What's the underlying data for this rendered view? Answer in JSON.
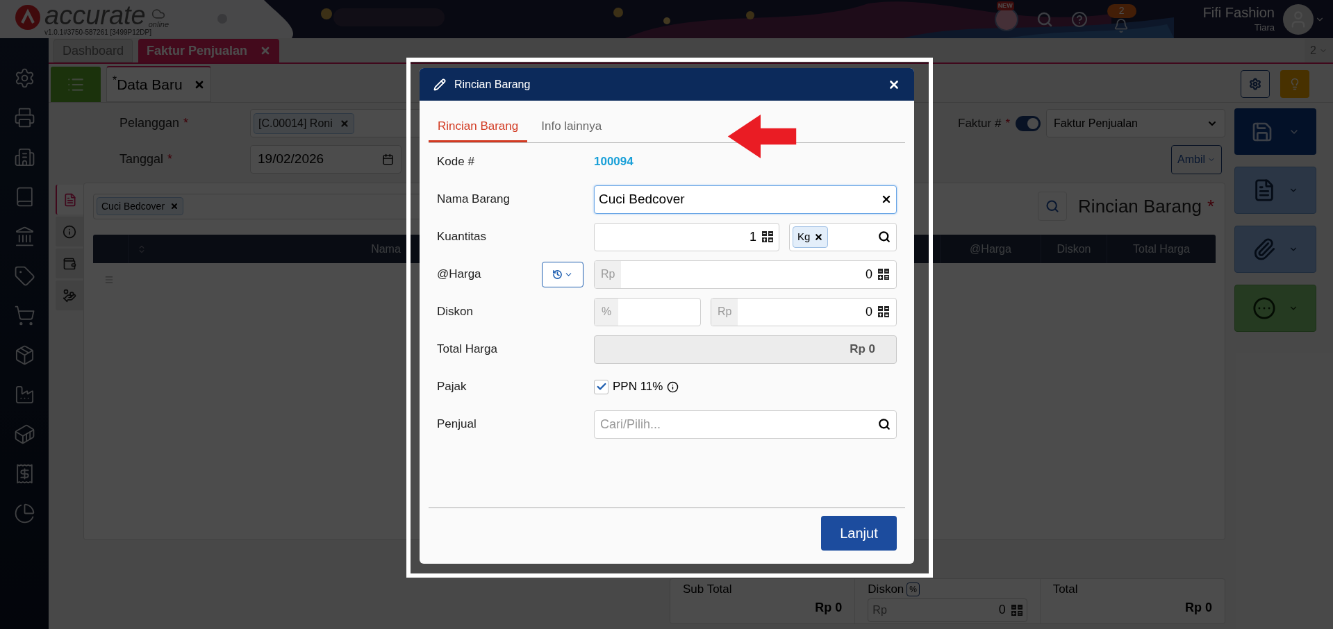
{
  "header": {
    "logo_word": "accurate",
    "logo_sub": "online",
    "version": "v1.0.1#3750-587261 [3499P12DP]",
    "new_badge": "NEW",
    "notification_count": "2",
    "company": "Fifi Fashion",
    "user": "Tiara"
  },
  "module_tabs": [
    {
      "label": "Dashboard",
      "selected": false,
      "closable": false
    },
    {
      "label": "Faktur Penjualan",
      "selected": true,
      "closable": true
    }
  ],
  "tab_counter": "2",
  "document_tab": {
    "label": "$^{*}$Data Baru"
  },
  "form": {
    "customer": {
      "label": "Pelanggan",
      "mark": "*",
      "value": "[C.00014] Roni"
    },
    "date": {
      "label": "Tanggal",
      "mark": "*",
      "value": "19/02/2026"
    },
    "invoice_no": {
      "label": "Faktur #",
      "mark": "*",
      "auto": true,
      "type_value": "Faktur Penjualan"
    },
    "fetch_button": "Ambil"
  },
  "detail_panel": {
    "side_tabs": [
      {
        "selected": true
      },
      {
        "selected": false
      },
      {
        "selected": false
      },
      {
        "selected": false
      }
    ],
    "item_filter": "Cuci Bedcover",
    "title": "Rincian Barang",
    "title_mark": "*",
    "columns": [
      "Nama",
      "@Harga",
      "Diskon",
      "Total Harga"
    ]
  },
  "summary": {
    "subtotal_label": "Sub Total",
    "subtotal": "Rp 0",
    "discount_label": "Diskon",
    "discount_unit": "%",
    "discount_prefix": "Rp",
    "discount_value": "0",
    "total_label": "Total",
    "total": "Rp 0"
  },
  "dialog": {
    "title": "Rincian Barang",
    "tabs": [
      {
        "label": "Rincian Barang",
        "selected": true
      },
      {
        "label": "Info lainnya",
        "selected": false
      }
    ],
    "fields": [
      {
        "kind": "text",
        "label": "Kode #",
        "value": "100094"
      },
      {
        "kind": "input",
        "label": "Nama Barang",
        "value": "Cuci Bedcover",
        "focused": true
      },
      {
        "kind": "quantity",
        "label": "Kuantitas",
        "value": "1",
        "unit": "Kg"
      },
      {
        "kind": "price",
        "label": "@Harga",
        "prefix": "Rp",
        "value": "0"
      },
      {
        "kind": "discount",
        "label": "Diskon",
        "percent_prefix": "%",
        "prefix": "Rp",
        "value": "0"
      },
      {
        "kind": "total",
        "label": "Total Harga",
        "value": "Rp 0"
      },
      {
        "kind": "checkbox",
        "label": "Pajak",
        "option": "PPN 11%",
        "checked": true
      },
      {
        "kind": "search",
        "label": "Penjual",
        "placeholder": "Cari/Pilih..."
      }
    ],
    "submit": "Lanjut"
  }
}
